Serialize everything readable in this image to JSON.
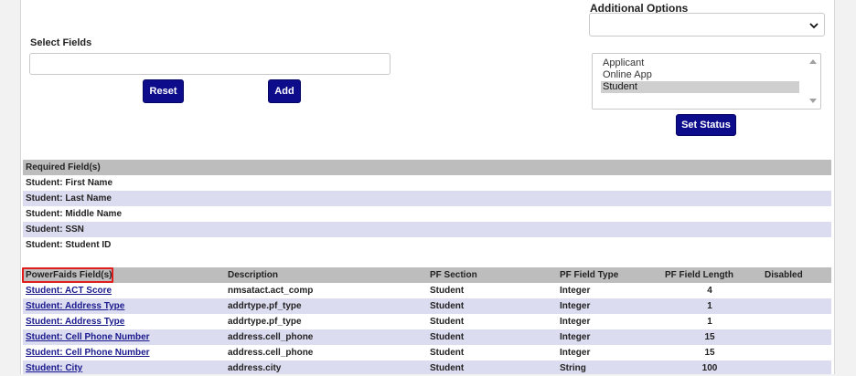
{
  "form": {
    "select_fields_label": "Select Fields",
    "select_fields_value": "",
    "reset_label": "Reset",
    "add_label": "Add"
  },
  "options": {
    "additional_options_label": "Additional Options",
    "additional_options_value": "",
    "status_list": [
      "Applicant",
      "Online App",
      "Student"
    ],
    "selected_status": "Student",
    "set_status_label": "Set Status"
  },
  "required": {
    "header": "Required Field(s)",
    "rows": [
      "Student: First Name",
      "Student: Last Name",
      "Student: Middle Name",
      "Student: SSN",
      "Student: Student ID"
    ]
  },
  "powerfaids": {
    "columns": {
      "field": "PowerFaids Field(s)",
      "description": "Description",
      "section": "PF Section",
      "type": "PF Field Type",
      "length": "PF Field Length",
      "disabled": "Disabled"
    },
    "rows": [
      {
        "field": "Student: ACT Score",
        "description": "nmsatact.act_comp",
        "section": "Student",
        "type": "Integer",
        "length": "4",
        "disabled": ""
      },
      {
        "field": "Student: Address Type",
        "description": "addrtype.pf_type",
        "section": "Student",
        "type": "Integer",
        "length": "1",
        "disabled": ""
      },
      {
        "field": "Student: Address Type",
        "description": "addrtype.pf_type",
        "section": "Student",
        "type": "Integer",
        "length": "1",
        "disabled": ""
      },
      {
        "field": "Student: Cell Phone Number",
        "description": "address.cell_phone",
        "section": "Student",
        "type": "Integer",
        "length": "15",
        "disabled": ""
      },
      {
        "field": "Student: Cell Phone Number",
        "description": "address.cell_phone",
        "section": "Student",
        "type": "Integer",
        "length": "15",
        "disabled": ""
      },
      {
        "field": "Student: City",
        "description": "address.city",
        "section": "Student",
        "type": "String",
        "length": "100",
        "disabled": ""
      }
    ]
  },
  "colors": {
    "button_bg": "#0d0d8c",
    "header_bg": "#bdbdbd",
    "alt_row_bg": "#dcdcf0",
    "link": "#1a1a8e",
    "highlight": "#e01c1c"
  },
  "icons": {
    "select_chevron": "chevron-down-icon",
    "list_scroll_up": "scroll-up-arrow-icon",
    "list_scroll_down": "scroll-down-arrow-icon"
  }
}
